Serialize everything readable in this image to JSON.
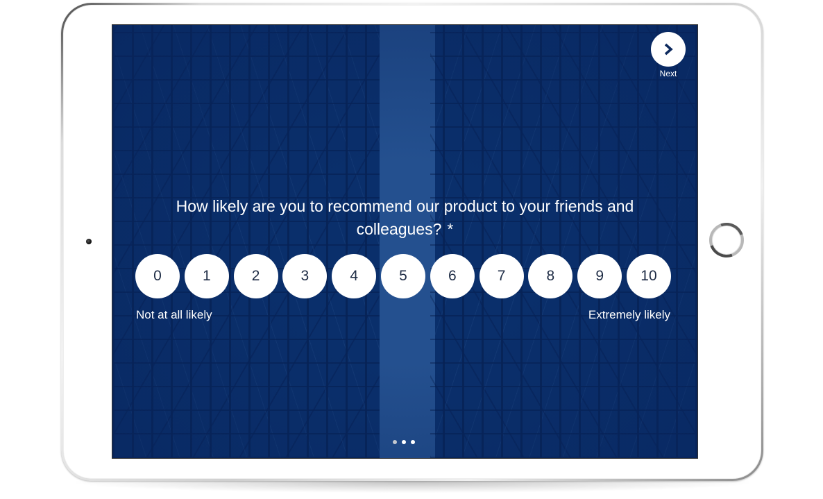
{
  "device": {
    "type": "tablet",
    "bezel_color": "#ffffff",
    "screen_bg": "#0a2f6b",
    "accent": "#24508f"
  },
  "navigation": {
    "next": {
      "label": "Next",
      "icon": "chevron-right-icon"
    }
  },
  "survey": {
    "question": "How likely are you to recommend our product to your friends and colleagues?",
    "required_marker": "*",
    "scale": {
      "options": [
        "0",
        "1",
        "2",
        "3",
        "4",
        "5",
        "6",
        "7",
        "8",
        "9",
        "10"
      ],
      "selected": null,
      "low_label": "Not at all likely",
      "high_label": "Extremely likely"
    }
  },
  "pagination": {
    "total": 3,
    "current": 1
  }
}
